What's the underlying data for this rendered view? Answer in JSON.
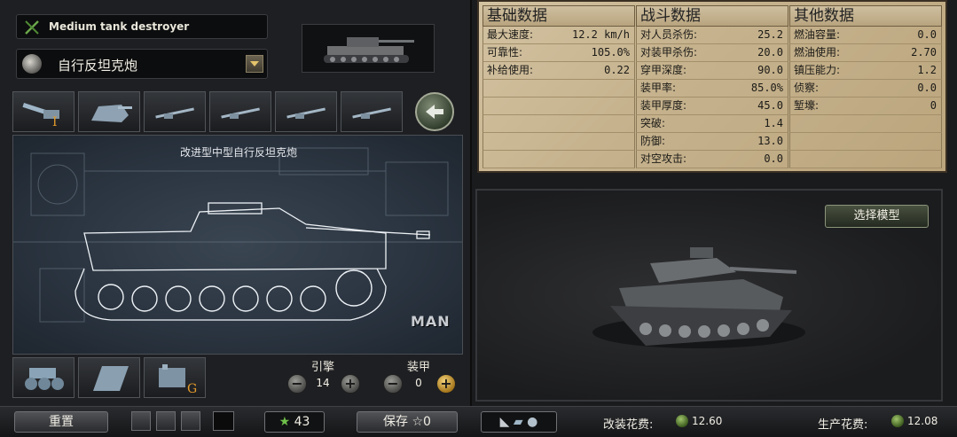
{
  "designer": {
    "unit_type": "Medium tank destroyer",
    "design_name": "自行反坦克炮",
    "variant_name": "改进型中型自行反坦克炮",
    "manufacturer": "MAN"
  },
  "upgrades": {
    "engine": {
      "label": "引擎",
      "value": "14"
    },
    "armor": {
      "label": "装甲",
      "value": "0"
    }
  },
  "stats": {
    "basic": {
      "header": "基础数据",
      "rows": [
        {
          "label": "最大速度:",
          "value": "12.2 km/h"
        },
        {
          "label": "可靠性:",
          "value": "105.0%"
        },
        {
          "label": "补给使用:",
          "value": "0.22"
        }
      ]
    },
    "combat": {
      "header": "战斗数据",
      "rows": [
        {
          "label": "对人员杀伤:",
          "value": "25.2"
        },
        {
          "label": "对装甲杀伤:",
          "value": "20.0"
        },
        {
          "label": "穿甲深度:",
          "value": "90.0"
        },
        {
          "label": "装甲率:",
          "value": "85.0%"
        },
        {
          "label": "装甲厚度:",
          "value": "45.0"
        },
        {
          "label": "突破:",
          "value": "1.4"
        },
        {
          "label": "防御:",
          "value": "13.0"
        },
        {
          "label": "对空攻击:",
          "value": "0.0"
        }
      ]
    },
    "other": {
      "header": "其他数据",
      "rows": [
        {
          "label": "燃油容量:",
          "value": "0.0"
        },
        {
          "label": "燃油使用:",
          "value": "2.70"
        },
        {
          "label": "镇压能力:",
          "value": "1.2"
        },
        {
          "label": "侦察:",
          "value": "0.0"
        },
        {
          "label": "堑壕:",
          "value": "0"
        }
      ]
    }
  },
  "model_viewer": {
    "choose_model_label": "选择模型"
  },
  "bottom_bar": {
    "reset_label": "重置",
    "xp_value": "43",
    "save_label": "保存",
    "save_count": "☆0",
    "refit_cost_label": "改装花费:",
    "refit_cost_value": "12.60",
    "production_cost_label": "生产花费:",
    "production_cost_value": "12.08"
  },
  "icons": {
    "type": "crossed-rifles-icon",
    "back": "return-arrow-icon"
  }
}
